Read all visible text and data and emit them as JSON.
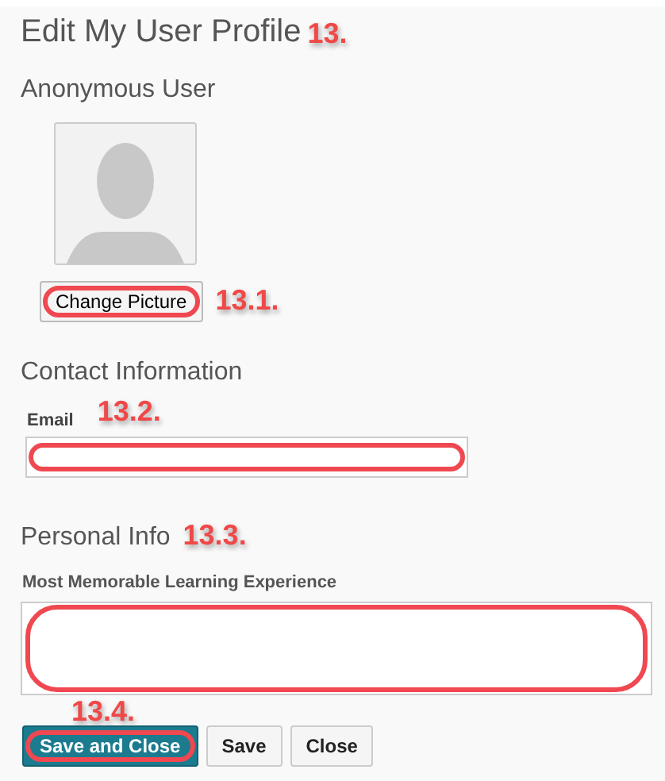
{
  "page": {
    "title": "Edit My User Profile",
    "annotation": "13."
  },
  "user": {
    "name": "Anonymous User"
  },
  "change_picture": {
    "label": "Change Picture",
    "highlighted": true,
    "annotation": "13.1."
  },
  "contact": {
    "heading": "Contact Information",
    "email_label": "Email",
    "annotation": "13.2.",
    "email_highlighted": true
  },
  "personal": {
    "heading": "Personal Info",
    "annotation": "13.3.",
    "field_label": "Most Memorable Learning Experience",
    "field_highlighted": true
  },
  "buttons_annotation": "13.4.",
  "buttons": [
    {
      "label": "Save and Close",
      "kind": "primary",
      "highlighted": true
    },
    {
      "label": "Save",
      "kind": "secondary",
      "highlighted": false
    },
    {
      "label": "Close",
      "kind": "secondary",
      "highlighted": false
    }
  ]
}
